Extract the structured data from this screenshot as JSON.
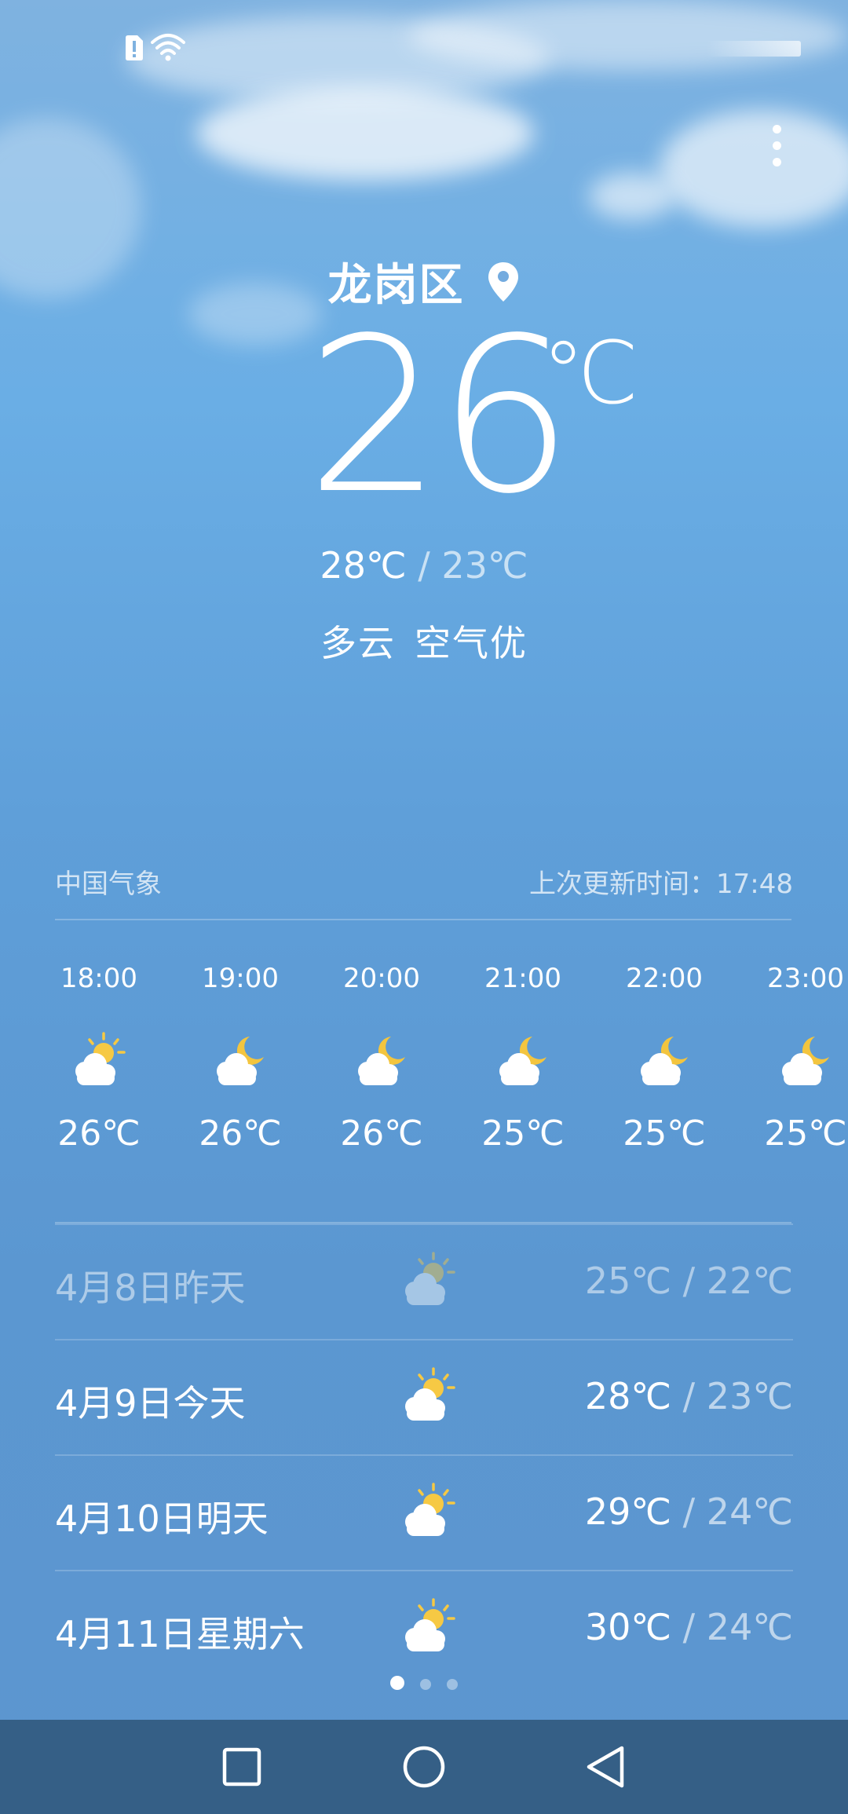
{
  "location": {
    "name": "龙岗区"
  },
  "current": {
    "temp": "26",
    "unit": "℃",
    "high": "28℃",
    "separator": "/",
    "low": "23℃",
    "condition": "多云",
    "air_quality": "空气优"
  },
  "source": {
    "provider": "中国气象",
    "updated": "上次更新时间：17:48"
  },
  "hourly": [
    {
      "time": "18:00",
      "icon": "partly-cloudy-day-icon",
      "temp": "26℃"
    },
    {
      "time": "19:00",
      "icon": "partly-cloudy-night-icon",
      "temp": "26℃"
    },
    {
      "time": "20:00",
      "icon": "partly-cloudy-night-icon",
      "temp": "26℃"
    },
    {
      "time": "21:00",
      "icon": "partly-cloudy-night-icon",
      "temp": "25℃"
    },
    {
      "time": "22:00",
      "icon": "partly-cloudy-night-icon",
      "temp": "25℃"
    },
    {
      "time": "23:00",
      "icon": "partly-cloudy-night-icon",
      "temp": "25℃"
    }
  ],
  "daily": [
    {
      "date": "4月8日昨天",
      "icon": "partly-cloudy-day-icon",
      "high": "25℃",
      "low": "22℃",
      "past": true
    },
    {
      "date": "4月9日今天",
      "icon": "partly-cloudy-day-icon",
      "high": "28℃",
      "low": "23℃",
      "past": false
    },
    {
      "date": "4月10日明天",
      "icon": "partly-cloudy-day-icon",
      "high": "29℃",
      "low": "24℃",
      "past": false
    },
    {
      "date": "4月11日星期六",
      "icon": "partly-cloudy-day-icon",
      "high": "30℃",
      "low": "24℃",
      "past": false
    }
  ],
  "pager": {
    "count": 3,
    "active": 0
  },
  "colors": {
    "sky_top": "#7fb2e0",
    "sky_bottom": "#5c96cf",
    "navbar": "#355f86",
    "sun": "#f6c944",
    "moon": "#f3c53f",
    "cloud": "#ffffff"
  },
  "icons": [
    "sim-alert-icon",
    "wifi-icon",
    "more-menu-icon",
    "location-pin-icon",
    "square-nav-icon",
    "home-circle-icon",
    "back-triangle-icon"
  ]
}
